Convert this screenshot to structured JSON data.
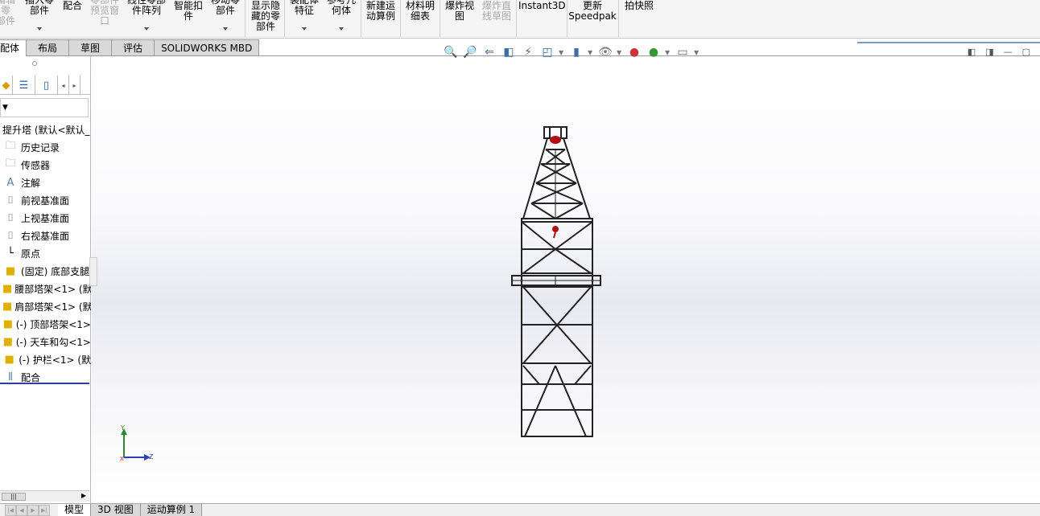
{
  "ribbon": {
    "buttons": [
      {
        "label": "编辑零\n部件",
        "disabled": true
      },
      {
        "label": "插入零\n部件",
        "disabled": false
      },
      {
        "label": "配合",
        "disabled": false
      },
      {
        "label": "零部件\n预览窗\n口",
        "disabled": true
      },
      {
        "label": "线性零部\n件阵列",
        "disabled": false
      },
      {
        "label": "智能扣\n件",
        "disabled": false
      },
      {
        "label": "移动零\n部件",
        "disabled": false
      },
      {
        "label": "显示隐\n藏的零\n部件",
        "disabled": false
      },
      {
        "label": "装配体\n特征",
        "disabled": false
      },
      {
        "label": "参考几\n何体",
        "disabled": false
      },
      {
        "label": "新建运\n动算例",
        "disabled": false
      },
      {
        "label": "材料明\n细表",
        "disabled": false
      },
      {
        "label": "爆炸视\n图",
        "disabled": false
      },
      {
        "label": "爆炸直\n线草图",
        "disabled": true
      },
      {
        "label": "Instant3D",
        "disabled": false
      },
      {
        "label": "更新\nSpeedpak",
        "disabled": false
      },
      {
        "label": "拍快照",
        "disabled": false
      }
    ]
  },
  "tabs": [
    "装配体",
    "布局",
    "草图",
    "评估",
    "SOLIDWORKS MBD"
  ],
  "tabs_visible": [
    "配体",
    "布局",
    "草图",
    "评估",
    "SOLIDWORKS MBD"
  ],
  "tree": {
    "root": "提升塔 (默认<默认_",
    "items": [
      {
        "label": "历史记录",
        "icon": "history-folder-icon"
      },
      {
        "label": "传感器",
        "icon": "sensor-folder-icon"
      },
      {
        "label": "注解",
        "icon": "annotation-folder-icon"
      },
      {
        "label": "前视基准面",
        "icon": "plane-icon"
      },
      {
        "label": "上视基准面",
        "icon": "plane-icon"
      },
      {
        "label": "右视基准面",
        "icon": "plane-icon"
      },
      {
        "label": "原点",
        "icon": "origin-icon"
      },
      {
        "label": "(固定) 底部支腿",
        "icon": "part-icon"
      },
      {
        "label": "腰部塔架<1> (默",
        "icon": "part-icon"
      },
      {
        "label": "肩部塔架<1> (默",
        "icon": "part-icon"
      },
      {
        "label": "(-) 顶部塔架<1>",
        "icon": "part-icon"
      },
      {
        "label": "(-) 天车和勾<1>",
        "icon": "part-icon"
      },
      {
        "label": "(-) 护栏<1> (默",
        "icon": "part-icon"
      },
      {
        "label": "配合",
        "icon": "mates-icon"
      }
    ]
  },
  "bottom_tabs": [
    "模型",
    "3D 视图",
    "运动算例 1"
  ],
  "triad": {
    "x": "X",
    "y": "Y",
    "z": "Z"
  },
  "colors": {
    "accent": "#2a3fa0",
    "hook": "#b01010"
  }
}
